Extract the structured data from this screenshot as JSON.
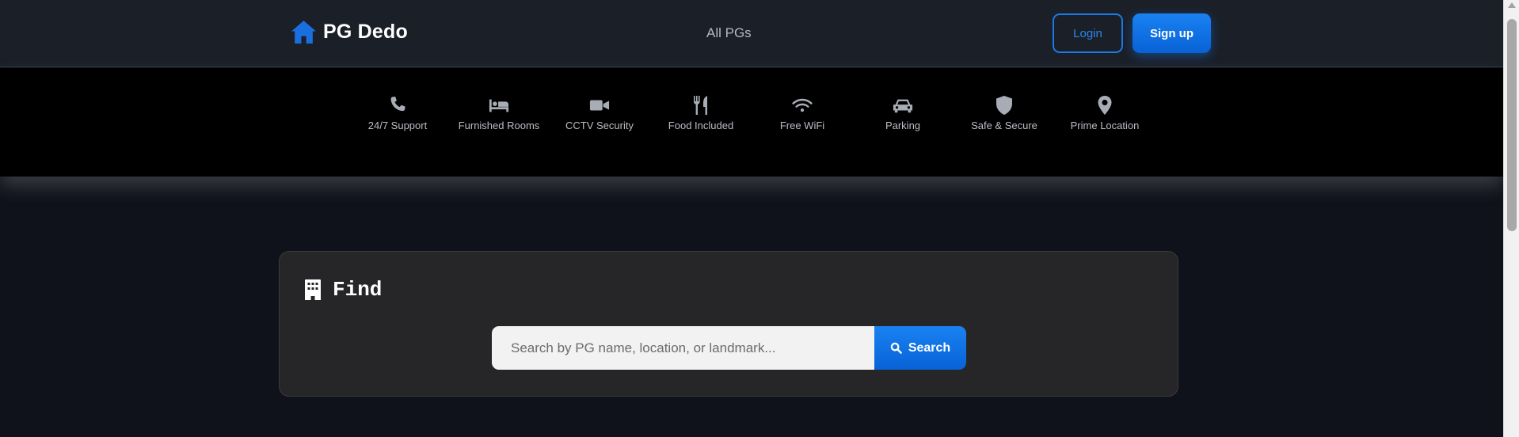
{
  "header": {
    "brand": "PG Dedo",
    "nav_link": "All PGs",
    "login_label": "Login",
    "signup_label": "Sign up"
  },
  "features": [
    {
      "icon": "phone-icon",
      "label": "24/7 Support"
    },
    {
      "icon": "bed-icon",
      "label": "Furnished Rooms"
    },
    {
      "icon": "video-camera-icon",
      "label": "CCTV Security"
    },
    {
      "icon": "utensils-icon",
      "label": "Food Included"
    },
    {
      "icon": "wifi-icon",
      "label": "Free WiFi"
    },
    {
      "icon": "car-icon",
      "label": "Parking"
    },
    {
      "icon": "shield-icon",
      "label": "Safe & Secure"
    },
    {
      "icon": "location-pin-icon",
      "label": "Prime Location"
    }
  ],
  "find": {
    "title": "Find",
    "search_placeholder": "Search by PG name, location, or landmark...",
    "search_label": "Search"
  },
  "colors": {
    "accent": "#1a7ae8",
    "header_bg": "#1b1f27",
    "page_bg": "#0f121a",
    "features_bg": "#000000",
    "card_bg": "#262628"
  }
}
